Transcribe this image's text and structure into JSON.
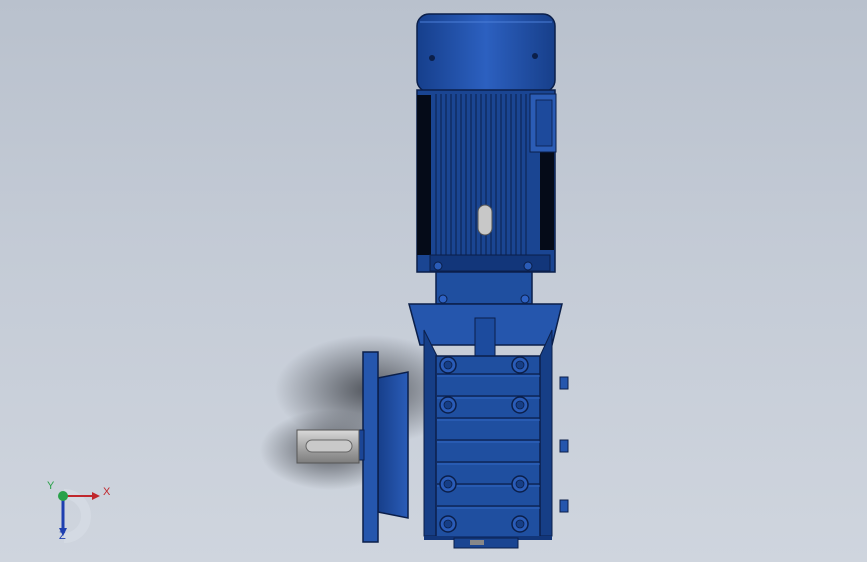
{
  "scene": {
    "background_top": "#b9c1cd",
    "background_bottom": "#cfd5de",
    "model": {
      "part": "geared motor",
      "body_color": "#1f4fa0",
      "body_highlight": "#3a6fd0",
      "body_shadow": "#0e2c66",
      "shaft_color": "#b8b8b8"
    }
  },
  "triad": {
    "x_label": "X",
    "y_label": "Y",
    "z_label": "Z",
    "x_color": "#c0282d",
    "y_color": "#2aa14a",
    "z_color": "#1e3fb0"
  }
}
